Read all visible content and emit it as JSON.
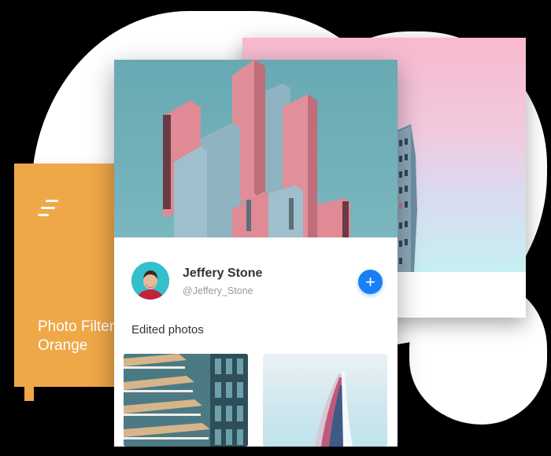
{
  "orange_card": {
    "title_line1": "Photo Filter",
    "title_line2": "Orange",
    "menu_icon": "menu-lines-icon",
    "color": "#efa847"
  },
  "profile": {
    "name": "Jeffery Stone",
    "handle": "@Jeffery_Stone",
    "add_label": "+",
    "section_title": "Edited photos",
    "accent": "#1a7ff2"
  },
  "photos": [
    {
      "name": "balconies-building"
    },
    {
      "name": "curved-tower"
    }
  ]
}
